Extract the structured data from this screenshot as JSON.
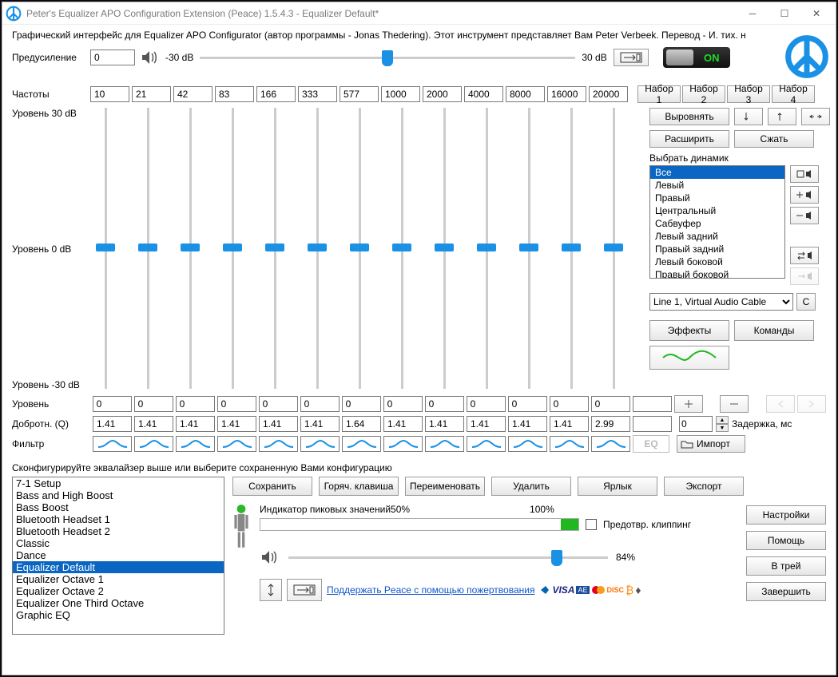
{
  "window": {
    "title": "Peter's Equalizer APO Configuration Extension (Peace) 1.5.4.3 - Equalizer Default*"
  },
  "description": "Графический интерфейс для Equalizer APO Configurator (автор программы - Jonas Thedering). Этот инструмент представляет Вам Peter Verbeek. Перевод - И. тих. н",
  "preamp": {
    "label": "Предусиление",
    "value": "0",
    "min_label": "-30 dB",
    "max_label": "30 dB",
    "lock_label": "",
    "on_label": "ON"
  },
  "frequencies": {
    "label": "Частоты",
    "values": [
      "10",
      "21",
      "42",
      "83",
      "166",
      "333",
      "577",
      "1000",
      "2000",
      "4000",
      "8000",
      "16000",
      "20000"
    ],
    "preset_buttons": [
      "Набор 1",
      "Набор 2",
      "Набор 3",
      "Набор 4"
    ]
  },
  "eq_labels": {
    "top": "Уровень 30 dB",
    "mid": "Уровень 0 dB",
    "bot": "Уровень -30 dB"
  },
  "side": {
    "flatten": "Выровнять",
    "expand": "Расширить",
    "compress": "Сжать",
    "select_speaker": "Выбрать динамик",
    "speakers": [
      "Все",
      "Левый",
      "Правый",
      "Центральный",
      "Сабвуфер",
      "Левый задний",
      "Правый задний",
      "Левый боковой",
      "Правый боковой"
    ],
    "device": "Line 1, Virtual Audio Cable",
    "device_c": "C",
    "effects": "Эффекты",
    "commands": "Команды"
  },
  "gain": {
    "label": "Уровень",
    "values": [
      "0",
      "0",
      "0",
      "0",
      "0",
      "0",
      "0",
      "0",
      "0",
      "0",
      "0",
      "0",
      "0"
    ]
  },
  "q": {
    "label": "Добротн. (Q)",
    "values": [
      "1.41",
      "1.41",
      "1.41",
      "1.41",
      "1.41",
      "1.41",
      "1.64",
      "1.41",
      "1.41",
      "1.41",
      "1.41",
      "1.41",
      "2.99"
    ]
  },
  "filter": {
    "label": "Фильтр",
    "import": "Импорт",
    "eq_label": "EQ"
  },
  "delay": {
    "value": "0",
    "label": "Задержка, мс"
  },
  "config_text": "Сконфигурируйте эквалайзер выше или выберите сохраненную Вами конфигурацию",
  "presets": [
    "7-1 Setup",
    "Bass and High Boost",
    "Bass Boost",
    "Bluetooth Headset 1",
    "Bluetooth Headset 2",
    "Classic",
    "Dance",
    "Equalizer Default",
    "Equalizer Octave 1",
    "Equalizer Octave 2",
    "Equalizer One Third Octave",
    "Graphic EQ"
  ],
  "selected_preset": "Equalizer Default",
  "actions": {
    "save": "Сохранить",
    "hotkey": "Горяч. клавиша",
    "rename": "Переименовать",
    "delete": "Удалить",
    "shortcut": "Ярлык",
    "export": "Экспорт"
  },
  "peak": {
    "label": "Индикатор пиковых значений",
    "mid": "50%",
    "hundred": "100%",
    "prevent_clipping": "Предотвр. клиппинг",
    "volume": "84%"
  },
  "rightbtns": {
    "settings": "Настройки",
    "help": "Помощь",
    "tray": "В трей",
    "exit": "Завершить"
  },
  "donate": {
    "text": "Поддержать Peace с помощью пожертвования"
  }
}
